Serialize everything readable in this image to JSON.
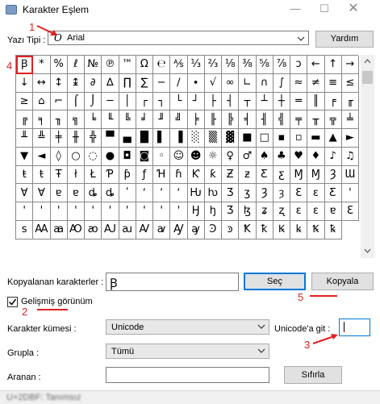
{
  "window": {
    "title": "Karakter Eşlem",
    "minimize_icon": "minimize-icon",
    "maximize_icon": "maximize-icon",
    "close_icon": "close-icon"
  },
  "font_row": {
    "label": "Yazı Tipi :",
    "value": "Arial",
    "help_button": "Yardım"
  },
  "characters": [
    "Ꞵ",
    "*",
    "%",
    "ℓ",
    "№",
    "℗",
    "™",
    "Ω",
    "℮",
    "⅍",
    "⅓",
    "⅔",
    "⅛",
    "⅜",
    "⅝",
    "⅞",
    "ↄ",
    "←",
    "↑",
    "→",
    "↓",
    "↔",
    "↕",
    "↨",
    "∂",
    "∆",
    "∏",
    "∑",
    "−",
    "∕",
    "∙",
    "√",
    "∞",
    "∟",
    "∩",
    "∫",
    "≈",
    "≠",
    "≡",
    "≤",
    "≥",
    "⌂",
    "⌐",
    "⌠",
    "⌡",
    "─",
    "│",
    "┌",
    "┐",
    "└",
    "┘",
    "├",
    "┤",
    "┬",
    "┴",
    "┼",
    "═",
    "║",
    "╒",
    "╓",
    "╔",
    "╕",
    "╖",
    "╗",
    "╘",
    "╙",
    "╚",
    "╛",
    "╜",
    "╝",
    "╞",
    "╟",
    "╠",
    "╡",
    "╢",
    "╣",
    "╤",
    "╥",
    "╦",
    "╧",
    "╨",
    "╩",
    "╪",
    "╫",
    "╬",
    "▀",
    "▄",
    "█",
    "▌",
    "▐",
    "░",
    "▒",
    "▓",
    "■",
    "□",
    "▪",
    "▫",
    "▬",
    "▲",
    "►",
    "▼",
    "◄",
    "◊",
    "○",
    "◌",
    "●",
    "◘",
    "◙",
    "◦",
    "☺",
    "☻",
    "☼",
    "♀",
    "♂",
    "♠",
    "♣",
    "♥",
    "♦",
    "♪",
    "♫",
    "ŧ",
    "ŧ",
    "Ŧ",
    "ł",
    "Ł",
    "Ƥ",
    "ƥ",
    "ƒ",
    "Ɦ",
    "ɦ",
    "Ƙ",
    "ƙ",
    "Ƶ",
    "ƶ",
    "Ƹ",
    "ƹ",
    "Ɱ",
    "Ɱ",
    "Ȝ",
    "Ɯ",
    "Ɐ",
    "Ɐ",
    "ɐ",
    "ɐ",
    "ȡ",
    "ȡ",
    "ʹ",
    "ʻ",
    "ʼ",
    "ʻ",
    "Ƕ",
    "ƕ",
    "Ʒ",
    "ʒ",
    "Ȝ",
    "ȝ",
    "Ɛ",
    "ɛ",
    "Ƹ",
    "'",
    "'",
    "'",
    "ꞌ",
    "ꞌ",
    "ꞌ",
    "ꞌ",
    "ꞌ",
    "ꞌ",
    "ꞌ",
    "ꞌ",
    "Ꜧ",
    "ꜧ",
    "Ʒ",
    "ɮ",
    "ʑ",
    "ʐ",
    "ɛ",
    "ɛ",
    "ɐ",
    "Ꜫ",
    "ꜱ",
    "Ꜳ",
    "ꜳ",
    "Ꜵ",
    "ꜵ",
    "Ꜷ",
    "ꜷ",
    "Ꜹ",
    "ꜹ",
    "Ꜽ",
    "ꜽ",
    "Ꜿ",
    "ꜿ",
    "Ꝁ",
    "ꝁ",
    "Ꝃ",
    "ꝃ",
    "Ꝅ",
    "ꝅ"
  ],
  "copy_row": {
    "label": "Kopyalanan karakterler :",
    "value": "Ꞵ",
    "select_button": "Seç",
    "copy_button": "Kopyala"
  },
  "advanced": {
    "label": "Gelişmiş görünüm"
  },
  "charset_row": {
    "label": "Karakter kümesi :",
    "value": "Unicode",
    "goto_label": "Unicode'a git :",
    "goto_value": ""
  },
  "group_row": {
    "label": "Grupla :",
    "value": "Tümü"
  },
  "search_row": {
    "label": "Aranan :",
    "value": "",
    "reset_button": "Sıfırla"
  },
  "status": {
    "text": "U+2DBF: Tanımsız"
  },
  "annotations": {
    "n1": "1",
    "n2": "2",
    "n3": "3",
    "n4": "4",
    "n5": "5"
  },
  "colors": {
    "annotation": "#e02020",
    "focus": "#0078d7"
  }
}
